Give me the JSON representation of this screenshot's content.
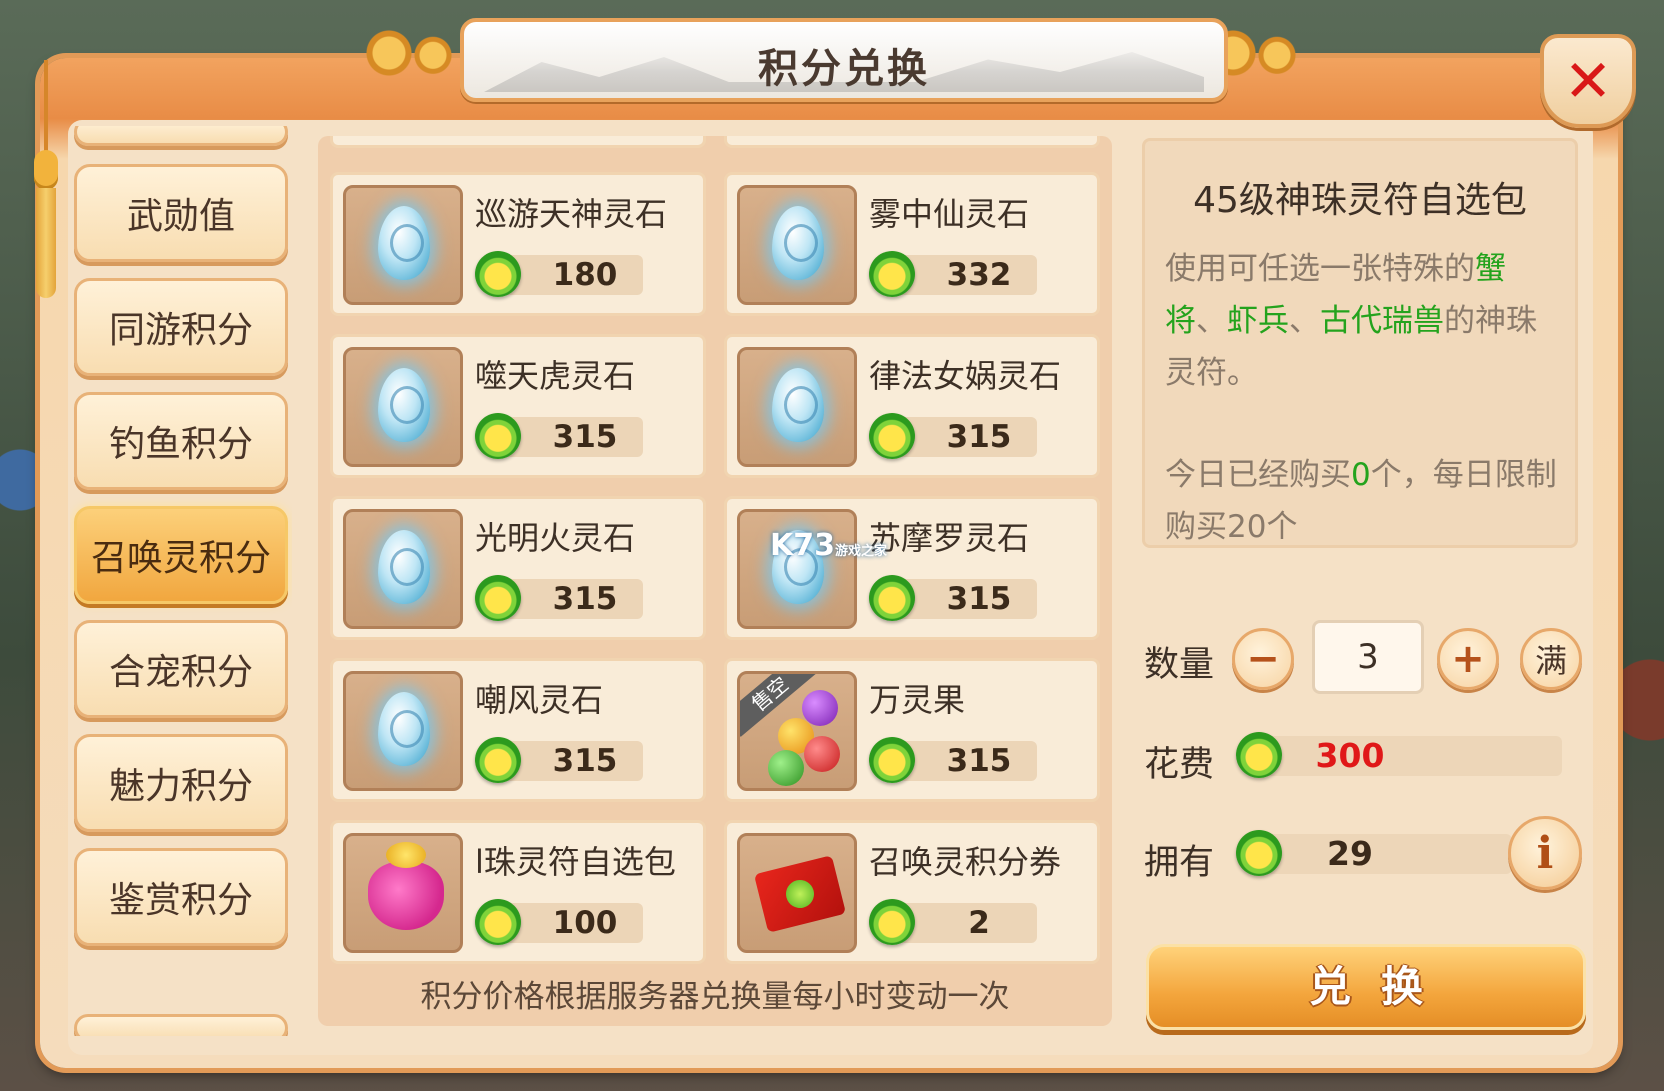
{
  "window": {
    "title": "积分兑换",
    "close_label": "✕"
  },
  "categories": [
    {
      "label": "武勋值",
      "active": false
    },
    {
      "label": "同游积分",
      "active": false
    },
    {
      "label": "钓鱼积分",
      "active": false
    },
    {
      "label": "召唤灵积分",
      "active": true
    },
    {
      "label": "合宠积分",
      "active": false
    },
    {
      "label": "魅力积分",
      "active": false
    },
    {
      "label": "鉴赏积分",
      "active": false
    }
  ],
  "items": [
    {
      "name": "巡游天神灵石",
      "price": "180",
      "icon": "spirit-stone-egg-icon"
    },
    {
      "name": "雾中仙灵石",
      "price": "332",
      "icon": "spirit-stone-egg-icon"
    },
    {
      "name": "噬天虎灵石",
      "price": "315",
      "icon": "spirit-stone-egg-icon"
    },
    {
      "name": "律法女娲灵石",
      "price": "315",
      "icon": "spirit-stone-egg-icon"
    },
    {
      "name": "光明火灵石",
      "price": "315",
      "icon": "spirit-stone-egg-icon"
    },
    {
      "name": "苏摩罗灵石",
      "price": "315",
      "icon": "spirit-stone-egg-icon"
    },
    {
      "name": "嘲风灵石",
      "price": "315",
      "icon": "spirit-stone-egg-icon"
    },
    {
      "name": "万灵果",
      "price": "315",
      "icon": "fruit-cluster-icon",
      "badge": "售空"
    },
    {
      "name": "l珠灵符自选包",
      "price": "100",
      "icon": "lucky-bag-icon"
    },
    {
      "name": "召唤灵积分券",
      "price": "2",
      "icon": "coupon-icon"
    }
  ],
  "grid_footer": "积分价格根据服务器兑换量每小时变动一次",
  "watermark": {
    "brand": "K73",
    "sub": "游戏之家"
  },
  "detail": {
    "title": "45级神珠灵符自选包",
    "desc_prefix": "使用可任选一张特殊的",
    "desc_highlight_1": "蟹将",
    "desc_sep_1": "、",
    "desc_highlight_2": "虾兵",
    "desc_sep_2": "、",
    "desc_highlight_3": "古代瑞兽",
    "desc_suffix": "的神珠灵符。",
    "limit_prefix": "今日已经购买",
    "limit_count": "0",
    "limit_suffix": "个，每日限制购买20个"
  },
  "purchase": {
    "quantity_label": "数量",
    "minus": "−",
    "quantity": "3",
    "plus": "+",
    "max_label": "满",
    "cost_label": "花费",
    "cost": "300",
    "own_label": "拥有",
    "own": "29",
    "info": "i",
    "exchange_label": "兑换"
  },
  "colors": {
    "accent_green": "#24a31d",
    "cost_red": "#e01818",
    "frame_orange": "#e88c46"
  }
}
